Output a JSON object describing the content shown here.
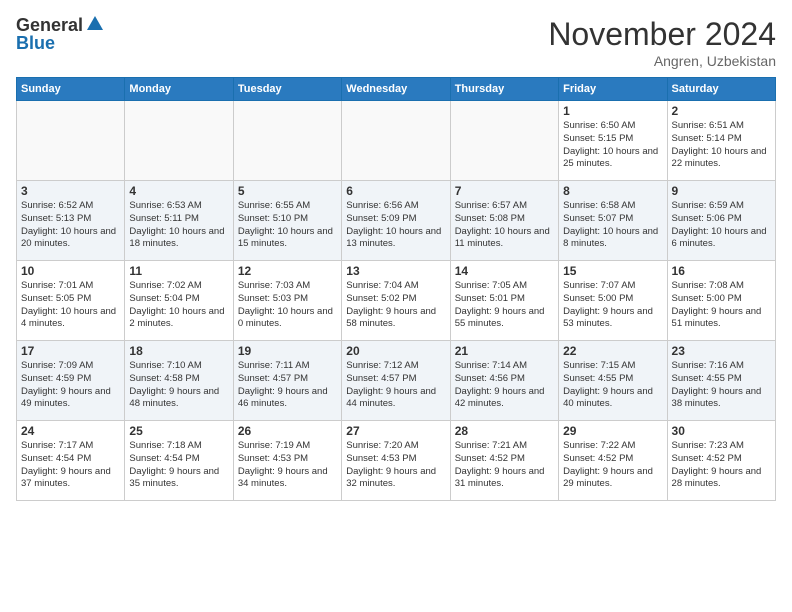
{
  "header": {
    "logo_general": "General",
    "logo_blue": "Blue",
    "month": "November 2024",
    "location": "Angren, Uzbekistan"
  },
  "days_of_week": [
    "Sunday",
    "Monday",
    "Tuesday",
    "Wednesday",
    "Thursday",
    "Friday",
    "Saturday"
  ],
  "weeks": [
    [
      {
        "day": "",
        "info": ""
      },
      {
        "day": "",
        "info": ""
      },
      {
        "day": "",
        "info": ""
      },
      {
        "day": "",
        "info": ""
      },
      {
        "day": "",
        "info": ""
      },
      {
        "day": "1",
        "info": "Sunrise: 6:50 AM\nSunset: 5:15 PM\nDaylight: 10 hours and 25 minutes."
      },
      {
        "day": "2",
        "info": "Sunrise: 6:51 AM\nSunset: 5:14 PM\nDaylight: 10 hours and 22 minutes."
      }
    ],
    [
      {
        "day": "3",
        "info": "Sunrise: 6:52 AM\nSunset: 5:13 PM\nDaylight: 10 hours and 20 minutes."
      },
      {
        "day": "4",
        "info": "Sunrise: 6:53 AM\nSunset: 5:11 PM\nDaylight: 10 hours and 18 minutes."
      },
      {
        "day": "5",
        "info": "Sunrise: 6:55 AM\nSunset: 5:10 PM\nDaylight: 10 hours and 15 minutes."
      },
      {
        "day": "6",
        "info": "Sunrise: 6:56 AM\nSunset: 5:09 PM\nDaylight: 10 hours and 13 minutes."
      },
      {
        "day": "7",
        "info": "Sunrise: 6:57 AM\nSunset: 5:08 PM\nDaylight: 10 hours and 11 minutes."
      },
      {
        "day": "8",
        "info": "Sunrise: 6:58 AM\nSunset: 5:07 PM\nDaylight: 10 hours and 8 minutes."
      },
      {
        "day": "9",
        "info": "Sunrise: 6:59 AM\nSunset: 5:06 PM\nDaylight: 10 hours and 6 minutes."
      }
    ],
    [
      {
        "day": "10",
        "info": "Sunrise: 7:01 AM\nSunset: 5:05 PM\nDaylight: 10 hours and 4 minutes."
      },
      {
        "day": "11",
        "info": "Sunrise: 7:02 AM\nSunset: 5:04 PM\nDaylight: 10 hours and 2 minutes."
      },
      {
        "day": "12",
        "info": "Sunrise: 7:03 AM\nSunset: 5:03 PM\nDaylight: 10 hours and 0 minutes."
      },
      {
        "day": "13",
        "info": "Sunrise: 7:04 AM\nSunset: 5:02 PM\nDaylight: 9 hours and 58 minutes."
      },
      {
        "day": "14",
        "info": "Sunrise: 7:05 AM\nSunset: 5:01 PM\nDaylight: 9 hours and 55 minutes."
      },
      {
        "day": "15",
        "info": "Sunrise: 7:07 AM\nSunset: 5:00 PM\nDaylight: 9 hours and 53 minutes."
      },
      {
        "day": "16",
        "info": "Sunrise: 7:08 AM\nSunset: 5:00 PM\nDaylight: 9 hours and 51 minutes."
      }
    ],
    [
      {
        "day": "17",
        "info": "Sunrise: 7:09 AM\nSunset: 4:59 PM\nDaylight: 9 hours and 49 minutes."
      },
      {
        "day": "18",
        "info": "Sunrise: 7:10 AM\nSunset: 4:58 PM\nDaylight: 9 hours and 48 minutes."
      },
      {
        "day": "19",
        "info": "Sunrise: 7:11 AM\nSunset: 4:57 PM\nDaylight: 9 hours and 46 minutes."
      },
      {
        "day": "20",
        "info": "Sunrise: 7:12 AM\nSunset: 4:57 PM\nDaylight: 9 hours and 44 minutes."
      },
      {
        "day": "21",
        "info": "Sunrise: 7:14 AM\nSunset: 4:56 PM\nDaylight: 9 hours and 42 minutes."
      },
      {
        "day": "22",
        "info": "Sunrise: 7:15 AM\nSunset: 4:55 PM\nDaylight: 9 hours and 40 minutes."
      },
      {
        "day": "23",
        "info": "Sunrise: 7:16 AM\nSunset: 4:55 PM\nDaylight: 9 hours and 38 minutes."
      }
    ],
    [
      {
        "day": "24",
        "info": "Sunrise: 7:17 AM\nSunset: 4:54 PM\nDaylight: 9 hours and 37 minutes."
      },
      {
        "day": "25",
        "info": "Sunrise: 7:18 AM\nSunset: 4:54 PM\nDaylight: 9 hours and 35 minutes."
      },
      {
        "day": "26",
        "info": "Sunrise: 7:19 AM\nSunset: 4:53 PM\nDaylight: 9 hours and 34 minutes."
      },
      {
        "day": "27",
        "info": "Sunrise: 7:20 AM\nSunset: 4:53 PM\nDaylight: 9 hours and 32 minutes."
      },
      {
        "day": "28",
        "info": "Sunrise: 7:21 AM\nSunset: 4:52 PM\nDaylight: 9 hours and 31 minutes."
      },
      {
        "day": "29",
        "info": "Sunrise: 7:22 AM\nSunset: 4:52 PM\nDaylight: 9 hours and 29 minutes."
      },
      {
        "day": "30",
        "info": "Sunrise: 7:23 AM\nSunset: 4:52 PM\nDaylight: 9 hours and 28 minutes."
      }
    ]
  ]
}
